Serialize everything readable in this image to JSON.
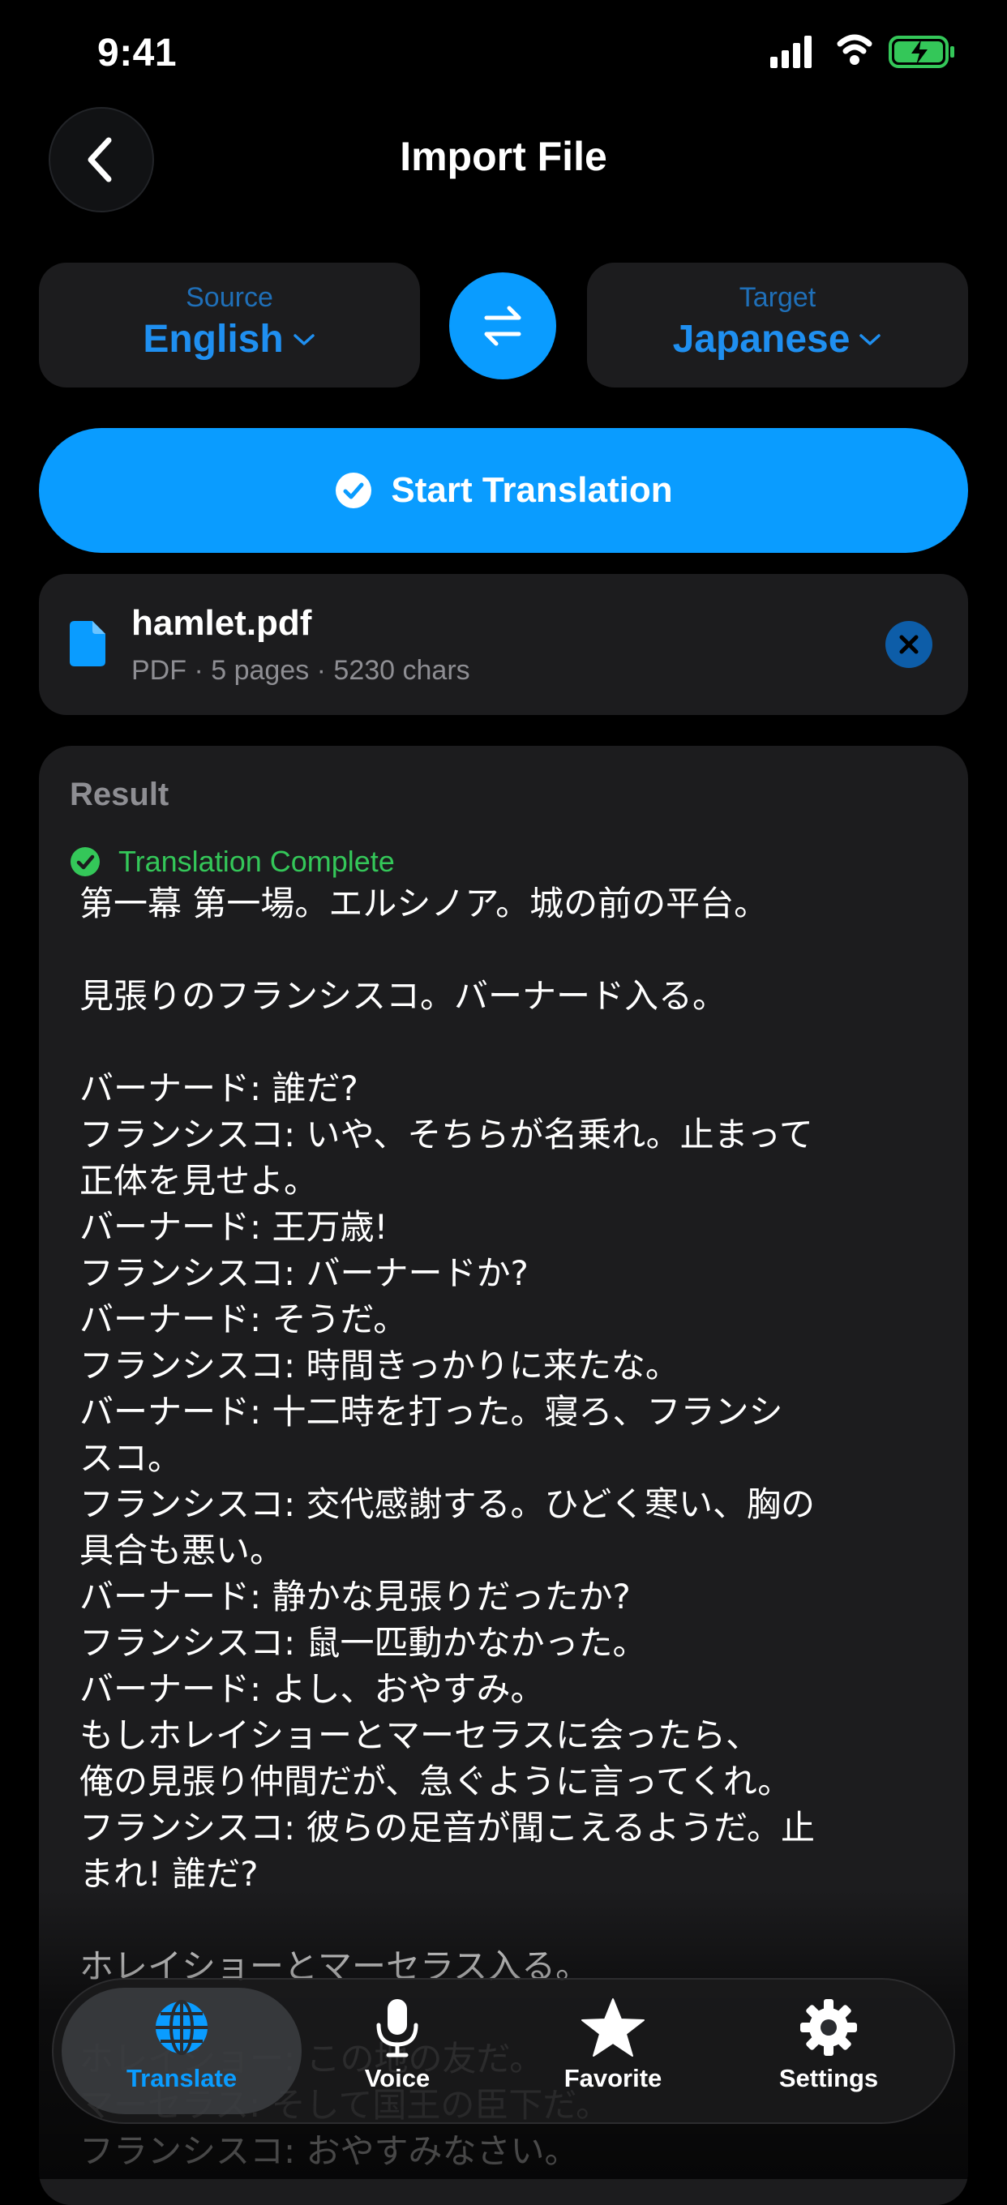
{
  "status_bar": {
    "time": "9:41"
  },
  "header": {
    "title": "Import File"
  },
  "languages": {
    "source_caption": "Source",
    "source_value": "English",
    "target_caption": "Target",
    "target_value": "Japanese"
  },
  "actions": {
    "start_label": "Start Translation"
  },
  "file": {
    "name": "hamlet.pdf",
    "meta": "PDF · 5 pages · 5230 chars"
  },
  "result": {
    "title": "Result",
    "status": "Translation Complete",
    "text": "第一幕 第一場。エルシノア。城の前の平台。\n\n見張りのフランシスコ。バーナード入る。\n\nバーナード: 誰だ?\nフランシスコ: いや、そちらが名乗れ。止まって\n正体を見せよ。\nバーナード: 王万歳!\nフランシスコ: バーナードか?\nバーナード: そうだ。\nフランシスコ: 時間きっかりに来たな。\nバーナード: 十二時を打った。寝ろ、フランシ\nスコ。\nフランシスコ: 交代感謝する。ひどく寒い、胸の\n具合も悪い。\nバーナード: 静かな見張りだったか?\nフランシスコ: 鼠一匹動かなかった。\nバーナード: よし、おやすみ。\nもしホレイショーとマーセラスに会ったら、\n俺の見張り仲間だが、急ぐように言ってくれ。\nフランシスコ: 彼らの足音が聞こえるようだ。止\nまれ! 誰だ?\n\nホレイショーとマーセラス入る。\n\nホレイショー: この地の友だ。\nマーセラス: そして国王の臣下だ。\nフランシスコ: おやすみなさい。"
  },
  "tabs": [
    {
      "label": "Translate",
      "icon": "globe-icon",
      "active": true
    },
    {
      "label": "Voice",
      "icon": "microphone-icon",
      "active": false
    },
    {
      "label": "Favorite",
      "icon": "star-icon",
      "active": false
    },
    {
      "label": "Settings",
      "icon": "gear-icon",
      "active": false
    }
  ],
  "colors": {
    "accent": "#0a9cff",
    "success": "#34c759",
    "card": "#1c1c1e",
    "background": "#000000"
  }
}
